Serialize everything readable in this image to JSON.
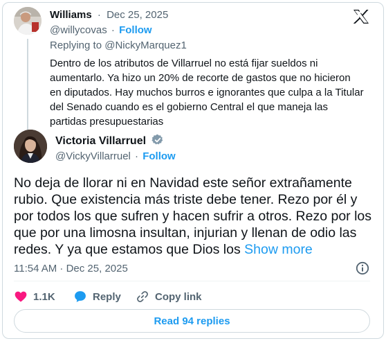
{
  "reply_tweet": {
    "author_name": "Williams",
    "separator": "·",
    "date": "Dec 25, 2025",
    "handle": "@willycovas",
    "follow_sep": "·",
    "follow_label": "Follow",
    "replying_prefix": "Replying to",
    "replying_handle": "@NickyMarquez1",
    "text": "Dentro de los atributos de Villarruel no está fijar sueldos ni aumentarlo. Ya hizo un 20% de recorte de gastos que no hicieron en diputados. Hay muchos burros e ignorantes que culpa a la Titular del Senado cuando es el gobierno Central el que maneja las partidas presupuestarias"
  },
  "main_tweet": {
    "author_name": "Victoria Villarruel",
    "handle": "@VickyVillarruel",
    "follow_sep": "·",
    "follow_label": "Follow",
    "text": "No deja de llorar ni en Navidad este señor extrañamente rubio. Que existencia más triste debe tener. Rezo por él y por todos los que sufren y hacen sufrir a otros. Rezo por los que por una limosna insultan, injurian y llenan de odio las redes. Y ya que estamos que Dios los",
    "show_more": "Show more",
    "timestamp": "11:54 AM · Dec 25, 2025"
  },
  "actions": {
    "like_count": "1.1K",
    "reply_label": "Reply",
    "copy_link_label": "Copy link"
  },
  "read_replies_label": "Read 94 replies",
  "colors": {
    "link_blue": "#1d9bf0",
    "muted": "#536471",
    "like_red": "#f91880",
    "verified_gray": "#829aab",
    "border": "#cfd9de"
  },
  "icons": [
    "x-logo-icon",
    "verified-badge-icon",
    "info-icon",
    "heart-icon",
    "reply-bubble-icon",
    "link-icon"
  ]
}
